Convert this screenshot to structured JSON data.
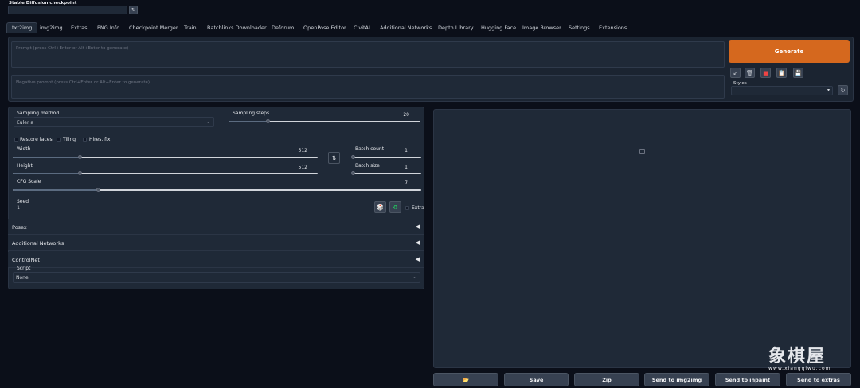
{
  "checkpoint": {
    "label": "Stable Diffusion checkpoint",
    "value": ""
  },
  "tabs": [
    "txt2img",
    "img2img",
    "Extras",
    "PNG Info",
    "Checkpoint Merger",
    "Train",
    "Batchlinks Downloader",
    "Deforum",
    "OpenPose Editor",
    "CivitAI",
    "Additional Networks",
    "Depth Library",
    "Hugging Face",
    "Image Browser",
    "Settings",
    "Extensions"
  ],
  "prompt": {
    "placeholder": "Prompt (press Ctrl+Enter or Alt+Enter to generate)"
  },
  "negative_prompt": {
    "placeholder": "Negative prompt (press Ctrl+Enter or Alt+Enter to generate)"
  },
  "generate_label": "Generate",
  "styles_label": "Styles",
  "sampling": {
    "method_label": "Sampling method",
    "method_value": "Euler a",
    "steps_label": "Sampling steps",
    "steps_value": "20",
    "steps_fraction": 0.2
  },
  "options": {
    "restore_faces": "Restore faces",
    "tiling": "Tiling",
    "hires_fix": "Hires. fix"
  },
  "size": {
    "width_label": "Width",
    "width_value": "512",
    "width_fraction": 0.22,
    "height_label": "Height",
    "height_value": "512",
    "height_fraction": 0.22
  },
  "batch": {
    "count_label": "Batch count",
    "count_value": "1",
    "size_label": "Batch size",
    "size_value": "1"
  },
  "cfg": {
    "label": "CFG Scale",
    "value": "7",
    "fraction": 0.21
  },
  "seed": {
    "label": "Seed",
    "value": "-1",
    "extra_label": "Extra"
  },
  "accordions": [
    "Posex",
    "Additional Networks",
    "ControlNet"
  ],
  "script": {
    "label": "Script",
    "value": "None"
  },
  "output_buttons": [
    "Save",
    "Zip",
    "Send to img2img",
    "Send to inpaint",
    "Send to extras"
  ],
  "watermark": {
    "cn": "象棋屋",
    "url": "www.xiangqiwu.com"
  },
  "colors": {
    "generate": "#d5681e",
    "background": "#0b0f19",
    "panel": "#1f2937"
  }
}
